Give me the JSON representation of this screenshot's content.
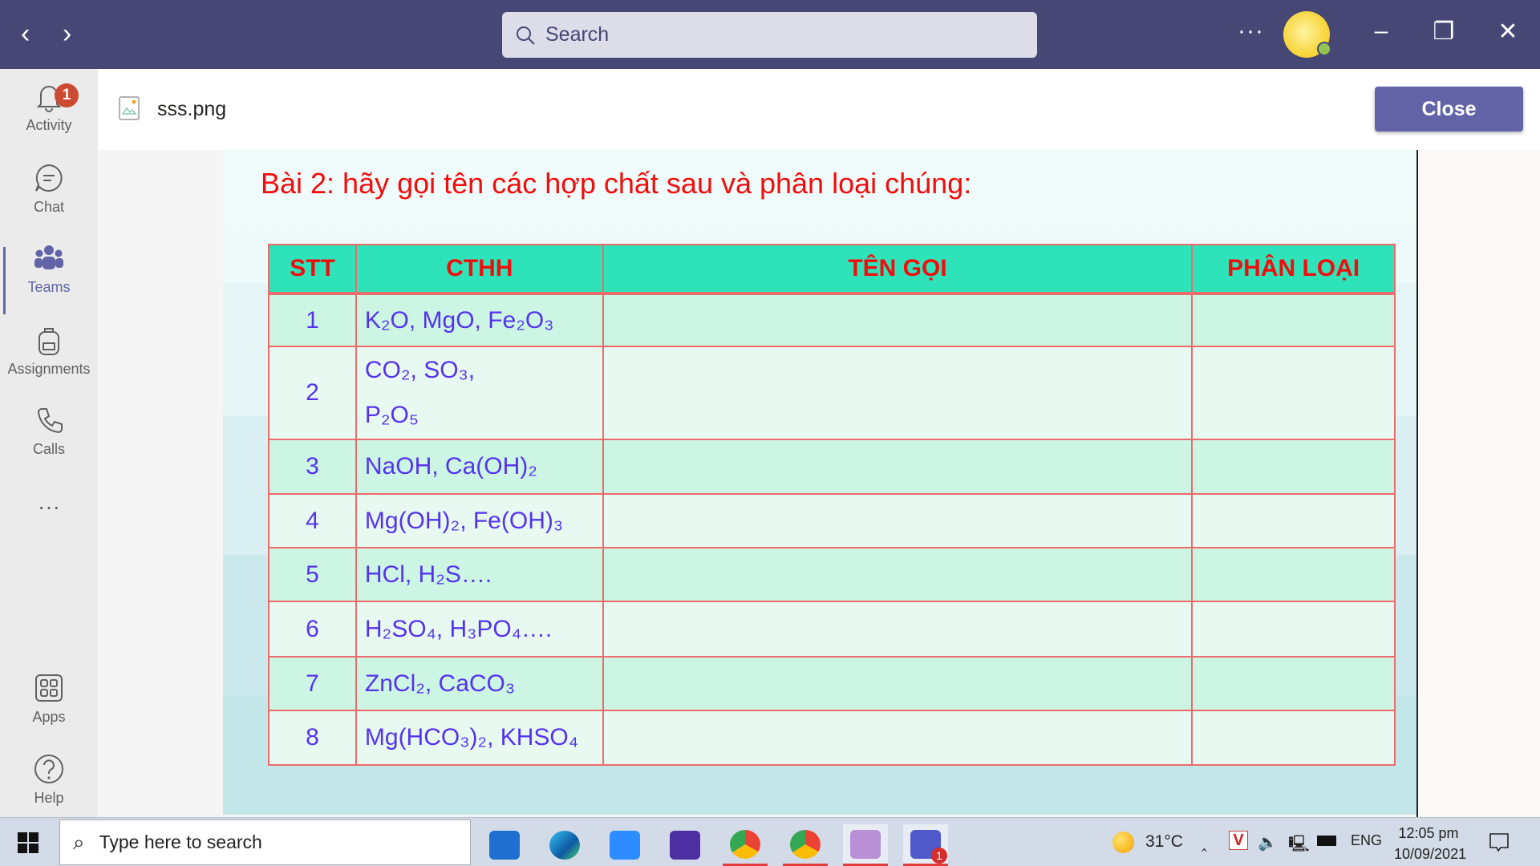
{
  "titlebar": {
    "search_placeholder": "Search",
    "more": "···"
  },
  "sidebar": {
    "items": [
      {
        "label": "Activity",
        "icon": "bell-icon",
        "badge": "1"
      },
      {
        "label": "Chat",
        "icon": "chat-icon"
      },
      {
        "label": "Teams",
        "icon": "teams-icon",
        "active": true
      },
      {
        "label": "Assignments",
        "icon": "backpack-icon"
      },
      {
        "label": "Calls",
        "icon": "phone-icon"
      },
      {
        "label": "",
        "icon": "more-icon"
      },
      {
        "label": "Apps",
        "icon": "apps-icon"
      },
      {
        "label": "Help",
        "icon": "help-icon"
      }
    ],
    "more": "···"
  },
  "header": {
    "file_name": "sss.png",
    "close_label": "Close"
  },
  "image": {
    "title": "Bài 2: hãy gọi tên các hợp chất sau và phân loại chúng:",
    "table": {
      "headers": [
        "STT",
        "CTHH",
        "TÊN GỌI",
        "PHÂN LOẠI"
      ],
      "rows": [
        {
          "stt": "1",
          "cthh": "K₂O, MgO, Fe₂O₃",
          "ten_goi": "",
          "phan_loai": ""
        },
        {
          "stt": "2",
          "cthh": "CO₂, SO₃,",
          "cthh2": "P₂O₅",
          "ten_goi": "",
          "phan_loai": ""
        },
        {
          "stt": "3",
          "cthh": "NaOH, Ca(OH)₂",
          "ten_goi": "",
          "phan_loai": ""
        },
        {
          "stt": "4",
          "cthh": "Mg(OH)₂, Fe(OH)₃",
          "ten_goi": "",
          "phan_loai": ""
        },
        {
          "stt": "5",
          "cthh": "HCl, H₂S….",
          "ten_goi": "",
          "phan_loai": ""
        },
        {
          "stt": "6",
          "cthh": "H₂SO₄, H₃PO₄….",
          "ten_goi": "",
          "phan_loai": ""
        },
        {
          "stt": "7",
          "cthh": "ZnCl₂, CaCO₃",
          "ten_goi": "",
          "phan_loai": ""
        },
        {
          "stt": "8",
          "cthh": "Mg(HCO₃)₂, KHSO₄",
          "ten_goi": "",
          "phan_loai": ""
        }
      ]
    }
  },
  "taskbar": {
    "search_placeholder": "Type here to search",
    "temperature": "31°C",
    "language": "ENG",
    "time": "12:05 pm",
    "date": "10/09/2021",
    "apps": [
      "mail",
      "edge",
      "zoom",
      "word-game",
      "chrome",
      "chrome",
      "photo-app",
      "teams"
    ],
    "teams_badge": "1"
  },
  "colors": {
    "accent": "#6264a7",
    "titlebar": "#464775",
    "header_row": "#2ee3b9",
    "title_text": "#f20d0d",
    "formula_text": "#5533ee"
  }
}
